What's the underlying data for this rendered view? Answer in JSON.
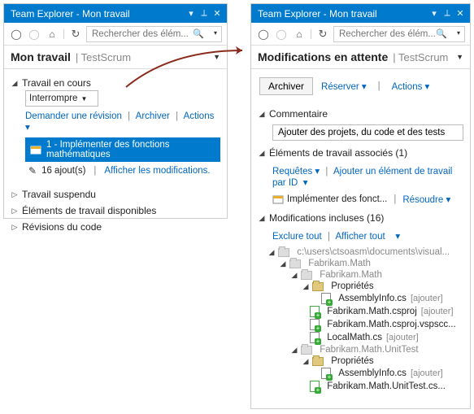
{
  "left": {
    "title": "Team Explorer - Mon travail",
    "search_placeholder": "Rechercher des élém...",
    "header_main": "Mon travail",
    "header_sub": "| TestScrum",
    "inprogress": {
      "title": "Travail en cours",
      "dropdown": "Interrompre",
      "review": "Demander une révision",
      "archive": "Archiver",
      "actions": "Actions",
      "item": "1 - Implémenter des fonctions mathématiques",
      "adds_count": "16 ajout(s)",
      "show_mods": "Afficher les modifications."
    },
    "sections": {
      "suspended": "Travail suspendu",
      "available": "Éléments de travail disponibles",
      "coderev": "Révisions du code"
    }
  },
  "right": {
    "title": "Team Explorer - Mon travail",
    "search_placeholder": "Rechercher des élém...",
    "header_main": "Modifications en attente",
    "header_sub": "| TestScrum",
    "archive_btn": "Archiver",
    "reserve": "Réserver",
    "actions": "Actions",
    "comment_label": "Commentaire",
    "comment_value": "Ajouter des projets, du code et des tests",
    "assoc": {
      "title": "Éléments de travail associés (1)",
      "queries": "Requêtes",
      "addbyid": "Ajouter un élément de travail par ID",
      "item": "Implémenter des fonct...",
      "resolve": "Résoudre"
    },
    "included": {
      "title": "Modifications incluses (16)",
      "exclude": "Exclure tout",
      "showall": "Afficher tout",
      "root": "c:\\users\\ctsoasm\\documents\\visual...",
      "proj1": "Fabrikam.Math",
      "proj1b": "Fabrikam.Math",
      "props": "Propriétés",
      "f1": "AssemblyInfo.cs",
      "f2": "Fabrikam.Math.csproj",
      "f3": "Fabrikam.Math.csproj.vspscc...",
      "f4": "LocalMath.cs",
      "proj2": "Fabrikam.Math.UnitTest",
      "f5": "AssemblyInfo.cs",
      "f6": "Fabrikam.Math.UnitTest.cs...",
      "tag": "[ajouter]"
    }
  }
}
